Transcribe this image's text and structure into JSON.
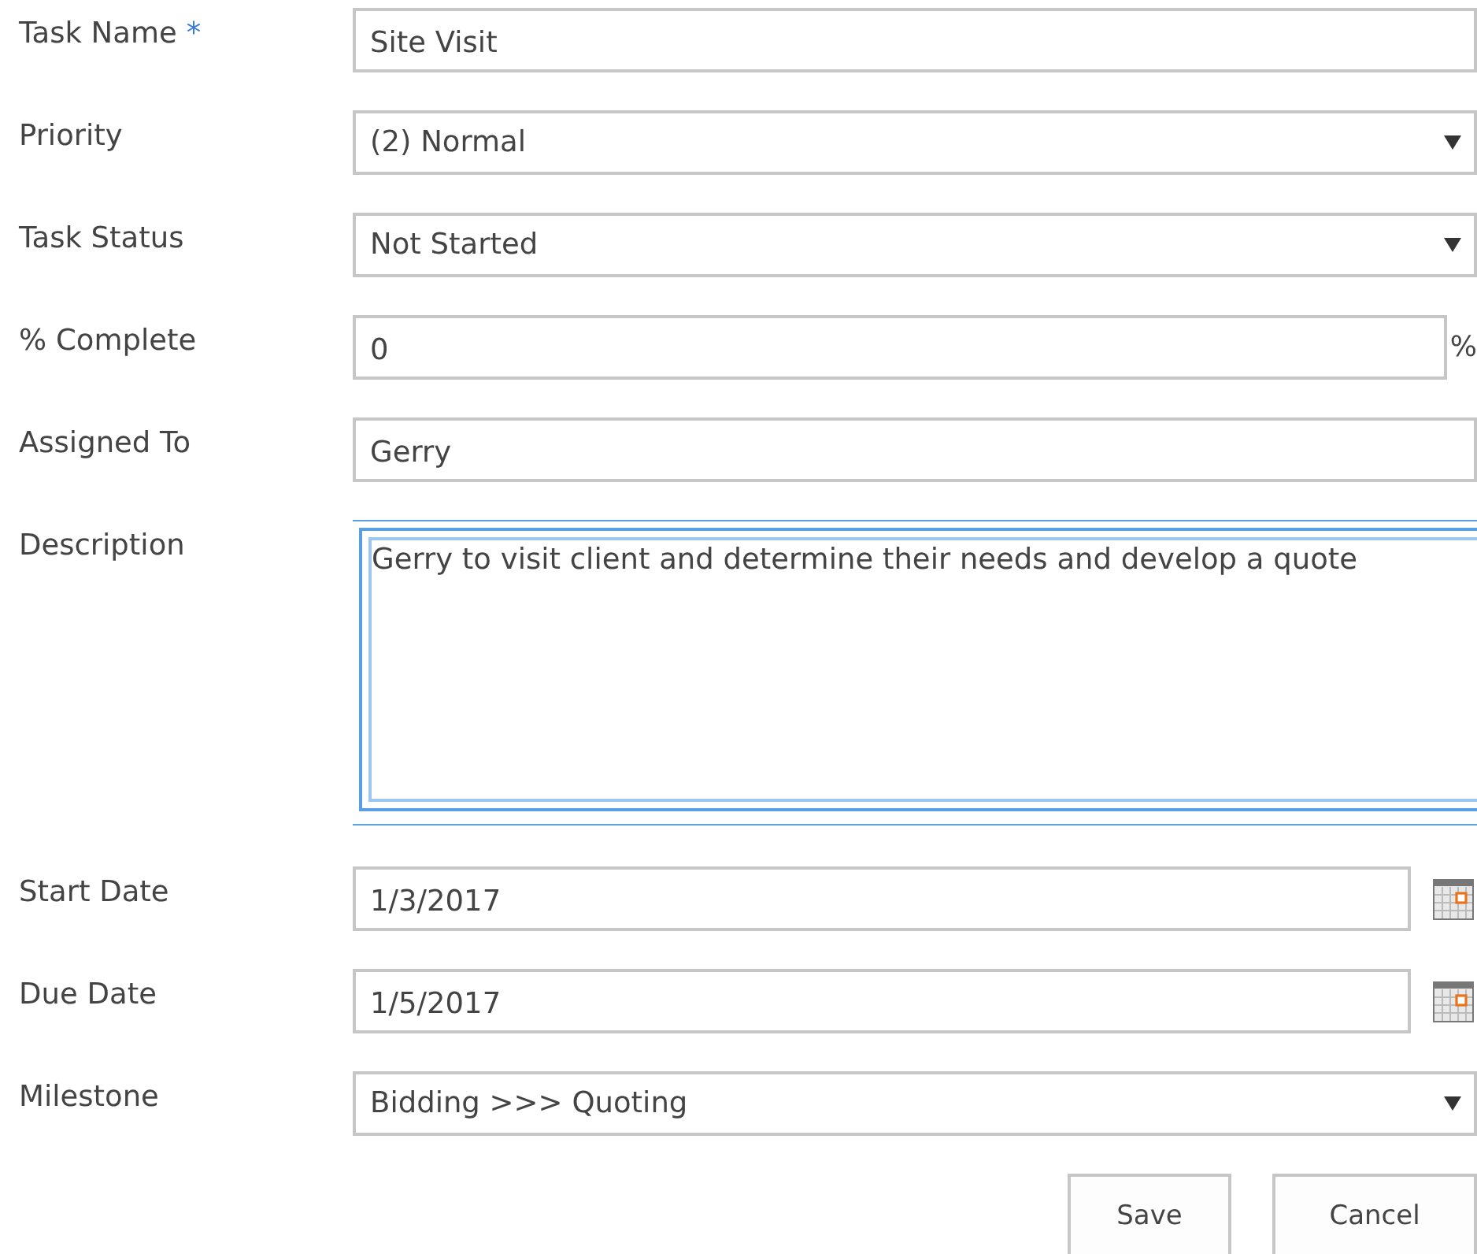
{
  "fields": [
    {
      "label": "Task Name",
      "required_mark": "*",
      "kind": "text",
      "value": "Site Visit"
    },
    {
      "label": "Priority",
      "kind": "select",
      "value": "(2) Normal"
    },
    {
      "label": "Task Status",
      "kind": "select",
      "value": "Not Started"
    },
    {
      "label": "% Complete",
      "kind": "percent",
      "value": "0",
      "suffix": "%"
    },
    {
      "label": "Assigned To",
      "kind": "text",
      "value": "Gerry"
    },
    {
      "label": "Description",
      "kind": "textarea",
      "value": "Gerry to visit client and determine their needs and develop a quote",
      "focused": true
    },
    {
      "label": "Start Date",
      "kind": "date",
      "value": "1/3/2017"
    },
    {
      "label": "Due Date",
      "kind": "date",
      "value": "1/5/2017"
    },
    {
      "label": "Milestone",
      "kind": "select",
      "value": "Bidding >>> Quoting"
    }
  ],
  "buttons": [
    "Save",
    "Cancel"
  ]
}
